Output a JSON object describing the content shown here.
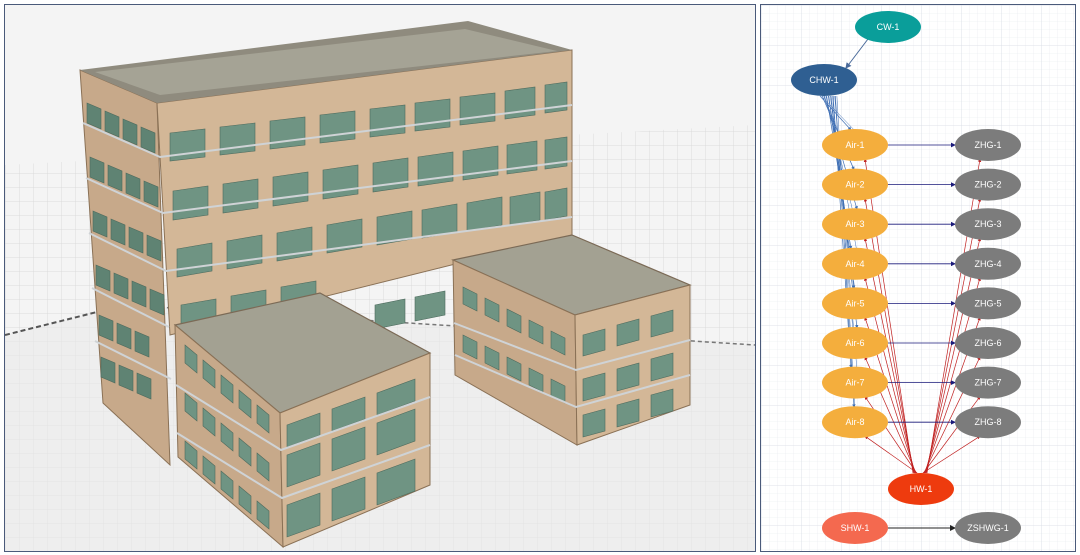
{
  "model_view": {
    "description_colors": {
      "wall": "#d2b596",
      "roof": "#a3a192",
      "window": "#6f9483",
      "floor": "#ededed"
    }
  },
  "plant_diagram": {
    "colors": {
      "cw": "#0a9e9a",
      "chw": "#2f5f92",
      "air": "#f4ae3d",
      "zhg": "#7c7c7c",
      "hw": "#ee3b0e",
      "shw": "#f4694f",
      "zshwg": "#7c7c7c",
      "chw_link": "#3f6fb4",
      "hw_link": "#c02020",
      "air_zone_link": "#1a1a7a",
      "grid": "#e4e8ee"
    },
    "nodes": {
      "cw": "CW-1",
      "chw": "CHW-1",
      "air": [
        "Air-1",
        "Air-2",
        "Air-3",
        "Air-4",
        "Air-5",
        "Air-6",
        "Air-7",
        "Air-8"
      ],
      "zhg": [
        "ZHG-1",
        "ZHG-2",
        "ZHG-3",
        "ZHG-4",
        "ZHG-5",
        "ZHG-6",
        "ZHG-7",
        "ZHG-8"
      ],
      "hw": "HW-1",
      "shw": "SHW-1",
      "zshwg": "ZSHWG-1"
    }
  }
}
